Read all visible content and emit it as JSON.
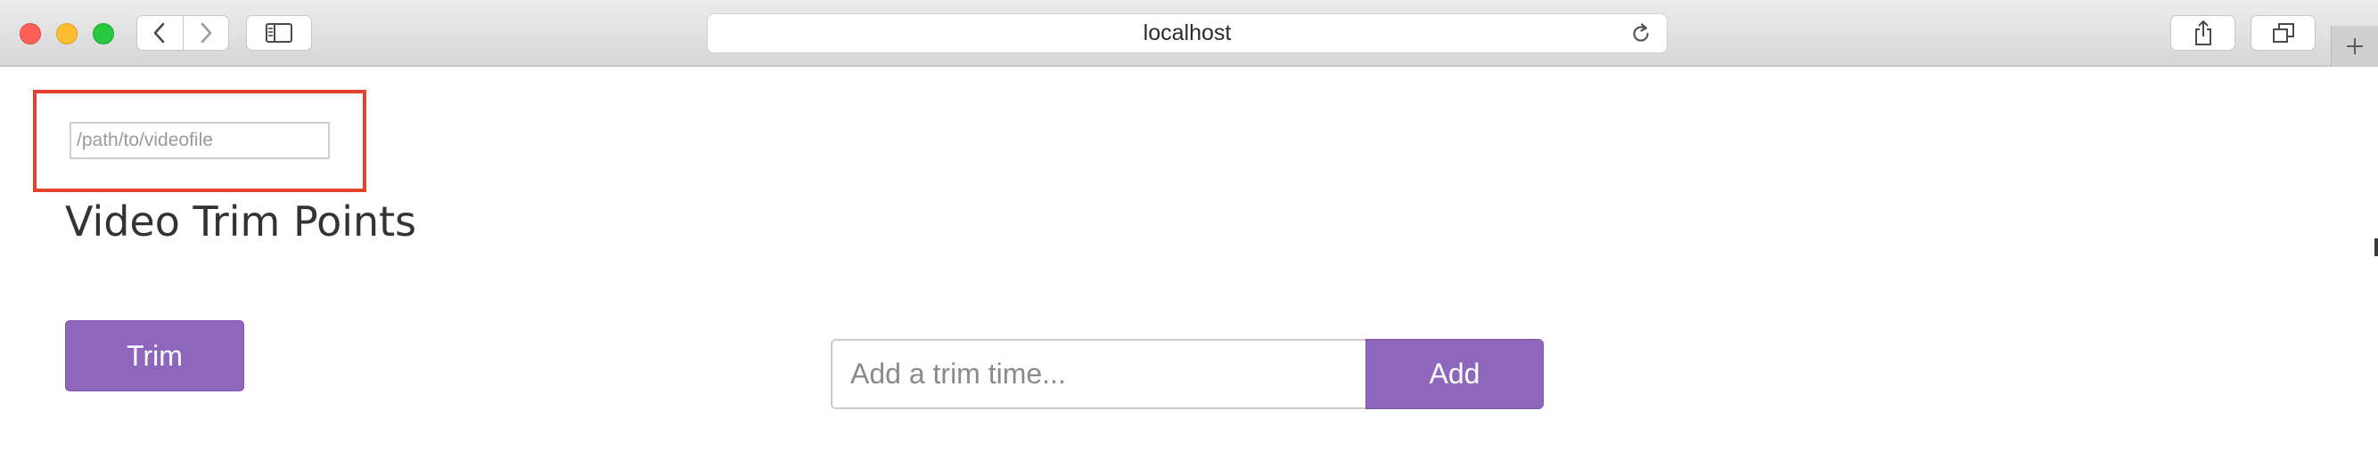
{
  "browser": {
    "url_label": "localhost",
    "icons": {
      "back": "chevron-left-icon",
      "forward": "chevron-right-icon",
      "sidebar": "sidebar-icon",
      "reload": "reload-icon",
      "share": "share-icon",
      "tabs": "tabs-overview-icon",
      "new_tab": "plus-icon"
    },
    "colors": {
      "close": "#fe5f57",
      "minimize": "#febc2e",
      "zoom": "#28c840"
    }
  },
  "page": {
    "video_path": {
      "placeholder": "/path/to/videofile",
      "value": ""
    },
    "title": "Video Trim Points",
    "trim_button_label": "Trim",
    "trim_time": {
      "placeholder": "Add a trim time...",
      "value": ""
    },
    "add_button_label": "Add",
    "colors": {
      "accent": "#8e67bd",
      "highlight": "#e5412b"
    }
  }
}
